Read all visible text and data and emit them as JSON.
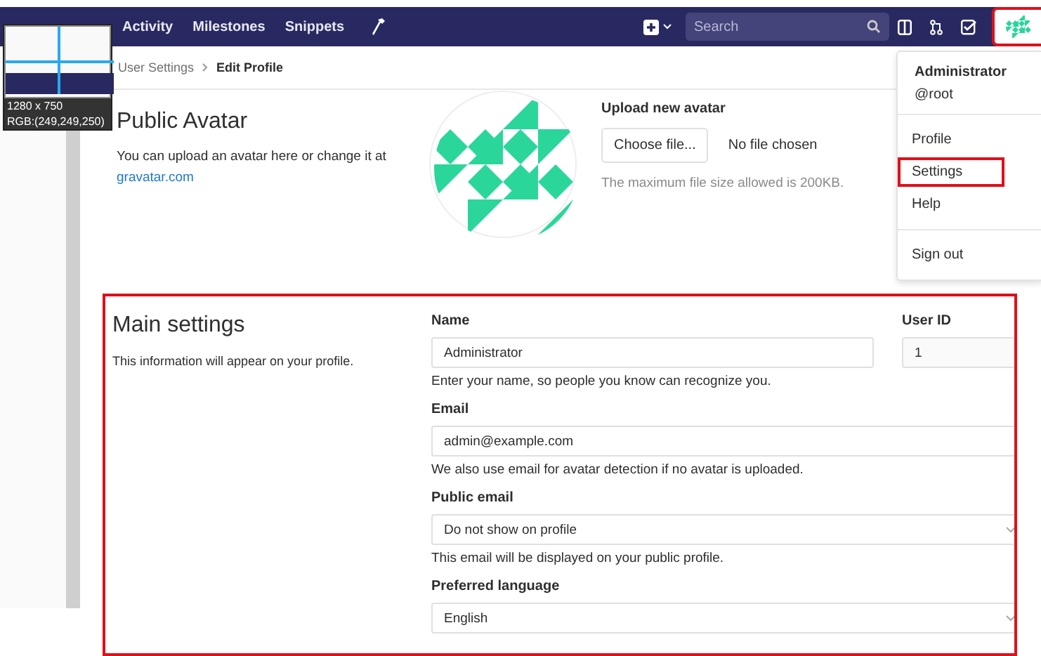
{
  "nav": {
    "links": [
      "Activity",
      "Milestones",
      "Snippets"
    ],
    "search": {
      "placeholder": "Search"
    },
    "avatar_highlighted": true
  },
  "capture_tool": {
    "size": "1280 x 750",
    "reading": "RGB:(249,249,250)"
  },
  "breadcrumb": [
    "User Settings",
    "Edit Profile"
  ],
  "avatar_section": {
    "title": "Public Avatar",
    "description": "You can upload an avatar here or change it at",
    "link": "gravatar.com",
    "upload_label": "Upload new avatar",
    "button": "Choose file...",
    "file_status": "No file chosen",
    "hint": "The maximum file size allowed is 200KB."
  },
  "main_settings": {
    "title": "Main settings",
    "description": "This information will appear on your profile.",
    "highlighted": true,
    "fields": [
      {
        "kind": "input",
        "label": "Name",
        "value": "Administrator",
        "help": "Enter your name, so people you know can recognize you.",
        "side": {
          "label": "User ID",
          "value": "1"
        }
      },
      {
        "kind": "input",
        "label": "Email",
        "value": "admin@example.com",
        "help": "We also use email for avatar detection if no avatar is uploaded."
      },
      {
        "kind": "select",
        "label": "Public email",
        "value": "Do not show on profile",
        "help": "This email will be displayed on your public profile."
      },
      {
        "kind": "select",
        "label": "Preferred language",
        "value": "English"
      }
    ]
  },
  "user_menu": {
    "name": "Administrator",
    "handle": "@root",
    "groups": [
      [
        {
          "label": "Profile",
          "highlighted": false
        },
        {
          "label": "Settings",
          "highlighted": true
        },
        {
          "label": "Help",
          "highlighted": false
        }
      ],
      [
        {
          "label": "Sign out",
          "highlighted": false
        }
      ]
    ]
  }
}
